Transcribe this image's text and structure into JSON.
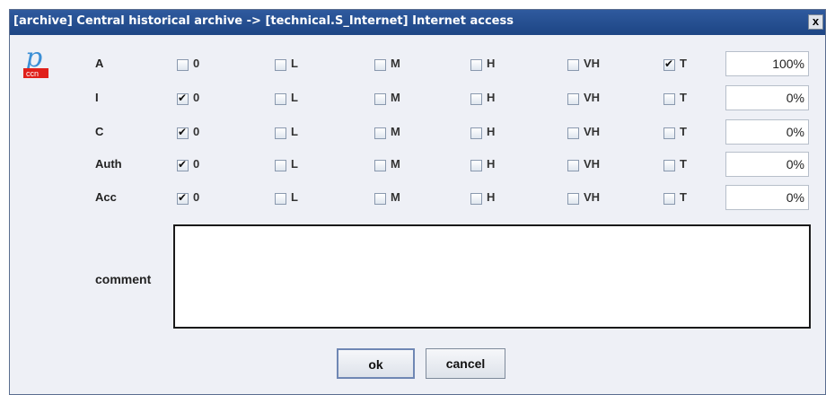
{
  "window": {
    "title": "[archive] Central historical archive -> [technical.S_Internet] Internet access",
    "close_label": "x"
  },
  "logo": {
    "text": "ccn",
    "icon": "pccn-logo-icon"
  },
  "options": [
    "0",
    "L",
    "M",
    "H",
    "VH",
    "T"
  ],
  "rows": [
    {
      "label": "A",
      "checked": "T",
      "value": "100%"
    },
    {
      "label": "I",
      "checked": "0",
      "value": "0%"
    },
    {
      "label": "C",
      "checked": "0",
      "value": "0%"
    },
    {
      "label": "Auth",
      "checked": "0",
      "value": "0%"
    },
    {
      "label": "Acc",
      "checked": "0",
      "value": "0%"
    }
  ],
  "comment": {
    "label": "comment",
    "value": ""
  },
  "buttons": {
    "ok": "ok",
    "cancel": "cancel"
  },
  "colors": {
    "titlebar": "#1d4584",
    "background": "#eef0f6",
    "logo_red": "#e0201a"
  }
}
